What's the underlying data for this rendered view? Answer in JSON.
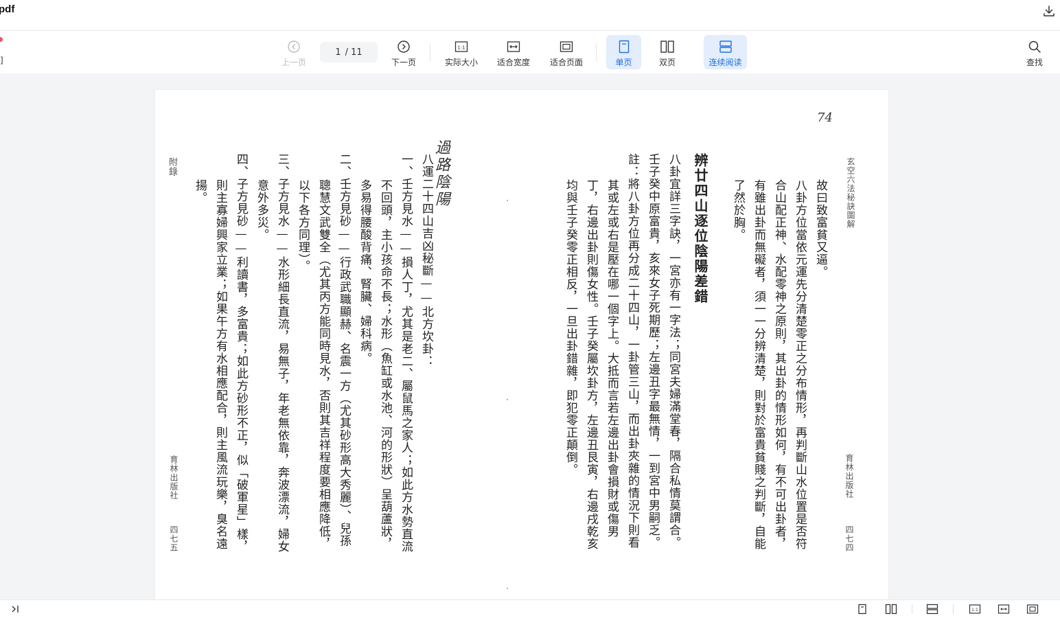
{
  "app": {
    "title": "pdf"
  },
  "toolbar": {
    "left_mark": "]",
    "prev_label": "上一页",
    "page_current": "1",
    "page_total": "/ 11",
    "next_label": "下一页",
    "actual_size_label": "实际大小",
    "fit_width_label": "适合宽度",
    "fit_page_label": "适合页面",
    "single_label": "单页",
    "double_label": "双页",
    "continuous_label": "连续阅读",
    "search_label": "查找",
    "icon_text_1to1": "1:1",
    "accent_color": "#1e6fe0",
    "active_bg": "#e3edfb"
  },
  "document": {
    "handwritten_page_number": "74",
    "right_page": {
      "running_head": "玄空六法秘訣圖解",
      "publisher": "育林出版社",
      "page_num": "四七四",
      "columns": [
        "故曰致富貧又逼。",
        "八卦方位當依元運先分清楚零正之分布情形，再判斷山水位置是否符",
        "合山配正神、水配零神之原則，其出卦的情形如何，有不可出卦者，",
        "有雖出卦而無礙者，須一一分辨清楚，則對於富貴貧賤之判斷，自能",
        "了然於胸。",
        "辨廿四山逐位陰陽差錯",
        "八卦宜詳三字訣，一宮亦有一字法；同宮夫婦滿堂春，隔合私情莫謂合。",
        "壬子癸中原富貴，亥來女子死期歷；左邊丑字最無情，一到宮中男嗣乏。",
        "註：將八卦方位再分成二十四山，一卦管三山，而出卦夾雜的情況下則看",
        "其或左或右是壓在哪一個字上。大抵而言若左邊出卦會損財或傷男",
        "丁，右邊出卦則傷女性。壬子癸屬坎卦方，左邊丑艮寅，右邊戌乾亥",
        "均與壬子癸零正相反，一旦出卦錯雜，即犯零正顛倒。"
      ]
    },
    "left_page": {
      "running_head": "附錄",
      "publisher": "育林出版社",
      "page_num": "四七五",
      "handwritten_title": "過路陰陽",
      "columns": [
        "八運二十四山吉凶秘斷——北方坎卦：",
        "一、壬方見水——損人丁，尤其是老二、屬鼠馬之家人；如此方水勢直流",
        "不回頭，主小孩命不長；水形（魚缸或水池、河的形狀）呈葫蘆狀，",
        "多易得腰酸背痛、腎臟、婦科病。",
        "二、壬方見砂——行政武職顯赫、名震一方（尤其砂形高大秀麗）、兒孫",
        "聰慧文武雙全（尤其丙方能同時見水，否則其吉祥程度要相應降低，",
        "以下各方同理）。",
        "三、子方見水——水形細長直流，易無子，年老無依靠，奔波漂流，婦女",
        "意外多災。",
        "四、子方見砂——利讀書，多富貴；如此方砂形不正，似「破軍星」樣，",
        "則主寡婦興家立業；如果午方有水相應配合，則主風流玩樂，臭名遠",
        "揚。"
      ]
    }
  }
}
